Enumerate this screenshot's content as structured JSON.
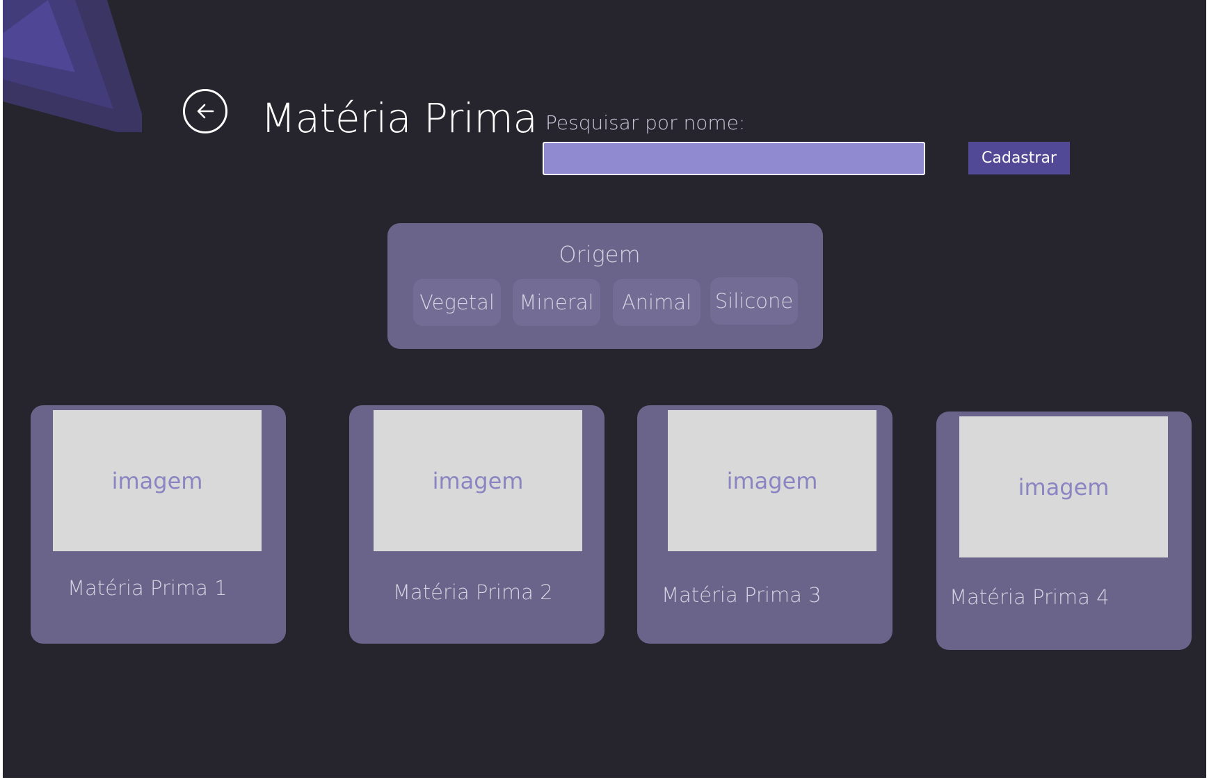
{
  "header": {
    "title": "Matéria Prima",
    "back_icon": "arrow-left-icon"
  },
  "search": {
    "label": "Pesquisar por nome:",
    "value": "",
    "placeholder": ""
  },
  "actions": {
    "register_label": "Cadastrar"
  },
  "filter": {
    "title": "Origem",
    "options": [
      "Vegetal",
      "Mineral",
      "Animal",
      "Silicone"
    ]
  },
  "cards": [
    {
      "image_label": "imagem",
      "name": "Matéria Prima 1"
    },
    {
      "image_label": "imagem",
      "name": "Matéria Prima 2"
    },
    {
      "image_label": "imagem",
      "name": "Matéria Prima 3"
    },
    {
      "image_label": "imagem",
      "name": "Matéria Prima 4"
    }
  ],
  "colors": {
    "background": "#26252d",
    "panel": "#6a648a",
    "accent": "#514896",
    "input": "#908bd0"
  }
}
